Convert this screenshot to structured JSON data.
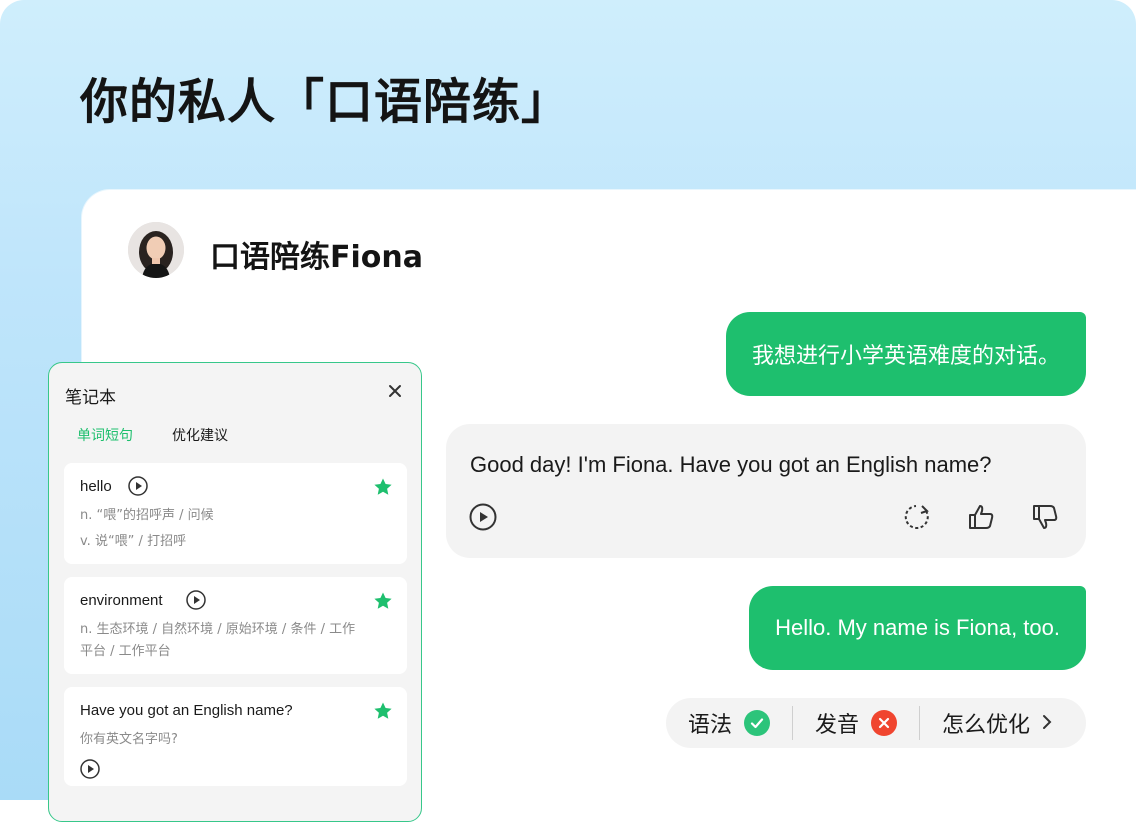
{
  "headline": "你的私人「口语陪练」",
  "agent": {
    "name": "口语陪练Fiona"
  },
  "messages": {
    "user_1": "我想进行小学英语难度的对话。",
    "bot_1": "Good day! I'm Fiona. Have you got an English name?",
    "user_2": "Hello. My name is Fiona, too."
  },
  "feedback": {
    "grammar_label": "语法",
    "pronunciation_label": "发音",
    "optimize_label": "怎么优化"
  },
  "notebook": {
    "title": "笔记本",
    "tabs": [
      "单词短句",
      "优化建议"
    ],
    "entries": [
      {
        "term": "hello",
        "lines": [
          "n. “喂”的招呼声 / 问候",
          "v. 说“喂” / 打招呼"
        ]
      },
      {
        "term": "environment",
        "lines": [
          "n. 生态环境 / 自然环境 / 原始环境 / 条件 / 工作",
          "平台 / 工作平台"
        ]
      },
      {
        "term": "Have you got an English name?",
        "lines": [
          "你有英文名字吗?"
        ]
      }
    ]
  },
  "colors": {
    "accent": "#1ebf6e",
    "success": "#2cc47a",
    "error": "#f0452f"
  }
}
